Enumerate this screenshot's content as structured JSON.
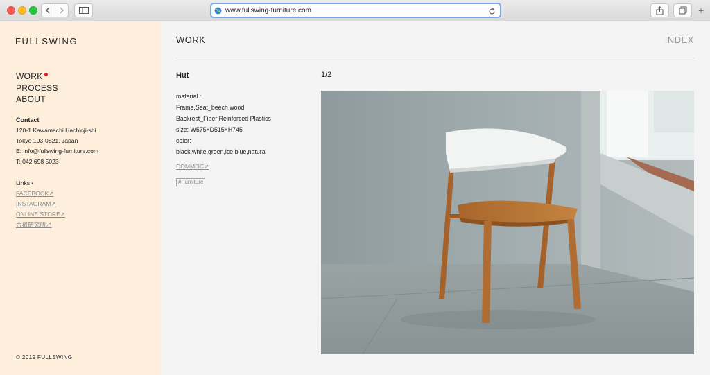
{
  "browser": {
    "url": "www.fullswing-furniture.com",
    "icons": {
      "back": "chevron-left-icon",
      "forward": "chevron-right-icon",
      "sidebar": "sidebar-icon",
      "globe": "globe-icon",
      "reload": "reload-icon",
      "share": "share-icon",
      "tabs": "tabs-icon",
      "new_tab": "plus-icon"
    }
  },
  "sidebar": {
    "logo": "FULLSWING",
    "nav": {
      "work": "WORK",
      "process": "PROCESS",
      "about": "ABOUT"
    },
    "contact": {
      "heading": "Contact",
      "address1": "120-1 Kawamachi Hachioji-shi",
      "address2": "Tokyo 193-0821, Japan",
      "email": "E: info@fullswing-furniture.com",
      "phone": "T: 042 698 5023"
    },
    "links": {
      "heading": "Links •",
      "items": [
        "FACEBOOK↗",
        "INSTAGRAM↗",
        "ONLINE STORE↗",
        "合板研究所↗"
      ]
    },
    "copyright": "© 2019  FULLSWING"
  },
  "main": {
    "section_title": "WORK",
    "index_link": "INDEX",
    "product": {
      "name": "Hut",
      "specs": [
        "material :",
        "Frame,Seat_beech wood",
        "Backrest_Fiber Reinforced Plastics",
        "size: W575×D515×H745",
        "color:",
        "black,white,green,ice blue,natural"
      ],
      "link": "COMMOC↗",
      "tag": "#Furniture"
    },
    "image_counter": "1/2"
  },
  "colors": {
    "sidebar_bg": "#fdefdc",
    "content_bg": "#f4f4f4",
    "accent_dot": "#e02020",
    "muted_link": "#8a8a8a"
  }
}
